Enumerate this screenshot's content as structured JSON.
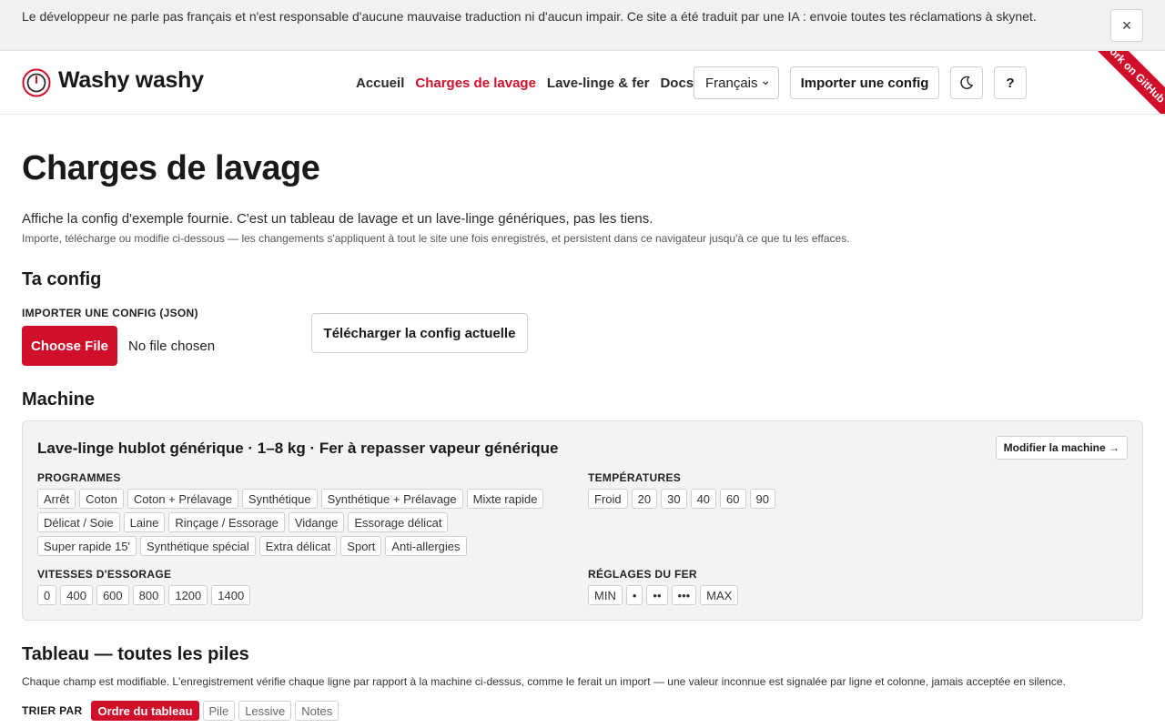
{
  "banner": {
    "text": "Le développeur ne parle pas français et n'est responsable d'aucune mauvaise traduction ni d'aucun impair. Ce site a été traduit par une IA : envoie toutes tes réclamations à skynet.",
    "close_label": "×"
  },
  "header": {
    "brand": "Washy washy",
    "nav": [
      "Accueil",
      "Charges de lavage",
      "Lave-linge & fer",
      "Docs"
    ],
    "active_nav": "Charges de lavage",
    "language": "Français",
    "language_chevron": "⌄",
    "import_label": "Importer une config",
    "theme_icon": "moon-icon",
    "help_label": "?",
    "ribbon": "Fork on GitHub"
  },
  "page": {
    "title": "Charges de lavage",
    "intro": "Affiche la config d'exemple fournie. C'est un tableau de lavage et un lave-linge génériques, pas les tiens.",
    "intro_sub": "Importe, télécharge ou modifie ci-dessous — les changements s'appliquent à tout le site une fois enregistrés, et persistent dans ce navigateur jusqu'à ce que tu les effaces."
  },
  "config": {
    "heading": "Ta config",
    "import_label": "IMPORTER UNE CONFIG (JSON)",
    "file_button": "Choose File",
    "file_status": "No file chosen",
    "download_label": "Télécharger la config actuelle"
  },
  "machine": {
    "heading": "Machine",
    "name": "Lave-linge hublot générique · 1–8 kg · Fer à repasser vapeur générique",
    "edit_label": "Modifier la machine →",
    "programs_label": "PROGRAMMES",
    "programs": [
      "Arrêt",
      "Coton",
      "Coton + Prélavage",
      "Synthétique",
      "Synthétique + Prélavage",
      "Mixte rapide",
      "Délicat / Soie",
      "Laine",
      "Rinçage / Essorage",
      "Vidange",
      "Essorage délicat",
      "Super rapide 15'",
      "Synthétique spécial",
      "Extra délicat",
      "Sport",
      "Anti-allergies"
    ],
    "temps_label": "TEMPÉRATURES",
    "temps": [
      "Froid",
      "20",
      "30",
      "40",
      "60",
      "90"
    ],
    "spins_label": "VITESSES D'ESSORAGE",
    "spins": [
      "0",
      "400",
      "600",
      "800",
      "1200",
      "1400"
    ],
    "iron_label": "RÉGLAGES DU FER",
    "iron": [
      "MIN",
      "•",
      "••",
      "•••",
      "MAX"
    ]
  },
  "table": {
    "heading": "Tableau — toutes les piles",
    "description": "Chaque champ est modifiable. L'enregistrement vérifie chaque ligne par rapport à la machine ci-dessus, comme le ferait un import — une valeur inconnue est signalée par ligne et colonne, jamais acceptée en silence.",
    "sort_label": "TRIER PAR",
    "sort_options": [
      "Ordre du tableau",
      "Pile",
      "Lessive",
      "Notes"
    ],
    "sort_active": "Ordre du tableau"
  },
  "colors": {
    "accent": "#d0102a",
    "card_bg": "#f3f3f3",
    "banner_bg": "#f1f1f1"
  }
}
